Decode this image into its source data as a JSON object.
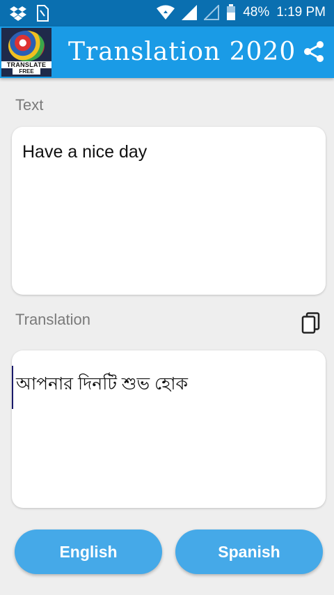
{
  "status_bar": {
    "battery": "48%",
    "time": "1:19 PM"
  },
  "app_bar": {
    "logo_line1": "TRANSLATE",
    "logo_line2": "FREE",
    "title": "Translation 2020"
  },
  "input_section": {
    "label": "Text",
    "value": "Have a nice day"
  },
  "output_section": {
    "label": "Translation",
    "value": "আপনার দিনটি শুভ হোক"
  },
  "language_buttons": {
    "source": "English",
    "target": "Spanish"
  },
  "colors": {
    "status_bar": "#0a6fb0",
    "app_bar": "#1a9be6",
    "button": "#45a9e8",
    "background": "#eeeeee"
  }
}
